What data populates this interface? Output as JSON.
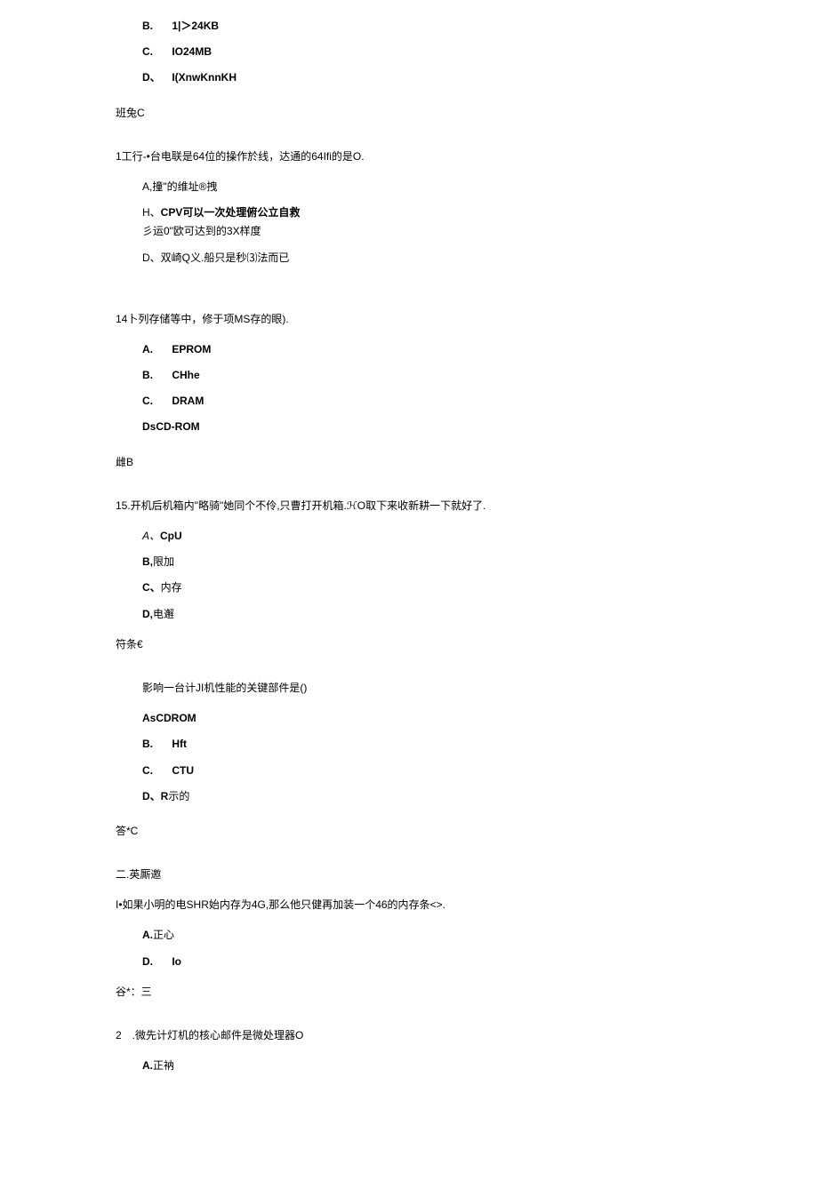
{
  "q12": {
    "options": [
      {
        "label": "B.",
        "text": "1|＞24KB"
      },
      {
        "label": "C.",
        "text": "IO24MB"
      },
      {
        "label": "D、",
        "text": "I(XnwKnnKH"
      }
    ],
    "answer": "班兔C"
  },
  "q13": {
    "question": "1工行-•台电联是64位的操作於线，达通的64Ifi的是O.",
    "options": [
      {
        "label": "A,",
        "text": "撞\"的维址®拽"
      },
      {
        "label": "H、",
        "text": "CPV可以一次处理俯公立自救"
      },
      {
        "label": "",
        "text": "彡运0\"欧可达到的3X样度"
      },
      {
        "label": "D、",
        "text": "双崎Q义.船只是秒⑶法而已"
      }
    ]
  },
  "q14": {
    "question": "14卜列存储等中，修于项MS存的眼).",
    "options": [
      {
        "label": "A.",
        "text": "EPROM"
      },
      {
        "label": "B.",
        "text": "CHhe"
      },
      {
        "label": "C.",
        "text": "DRAM"
      },
      {
        "label": "",
        "text": "DsCD-ROM"
      }
    ],
    "answer": "雌B"
  },
  "q15": {
    "question": "15.开机后机箱内\"略骑\"她同个不伶,只曹打开机箱.ℋO取下来收新耕一下就好了.",
    "options": [
      {
        "label": "A、",
        "text": "CpU"
      },
      {
        "label": "B,",
        "text": "限加"
      },
      {
        "label": "C、",
        "text": "内存"
      },
      {
        "label": "D,",
        "text": "电邂"
      }
    ],
    "answer": "符条€"
  },
  "q16": {
    "question": "影响一台计JI机性能的关键部件是()",
    "options": [
      {
        "label": "",
        "text": "AsCDROM"
      },
      {
        "label": "B.",
        "text": "Hft"
      },
      {
        "label": "C.",
        "text": "CTU"
      },
      {
        "label": "D、",
        "text": "R示的"
      }
    ],
    "answer": "答*C"
  },
  "section2": {
    "header": "二.英厮邀",
    "q1": {
      "question": "I•如果小明的电SHR始内存为4G,那么他只健再加装一个46的内存条<>.",
      "options": [
        {
          "label": "A.",
          "text": "正心"
        },
        {
          "label": "D.",
          "text": "Io"
        }
      ],
      "answer": "谷*：三"
    },
    "q2": {
      "question": "2　.微先计灯机的核心邮件是微处理器O",
      "options": [
        {
          "label": "A.",
          "text": "正衲"
        }
      ]
    }
  }
}
